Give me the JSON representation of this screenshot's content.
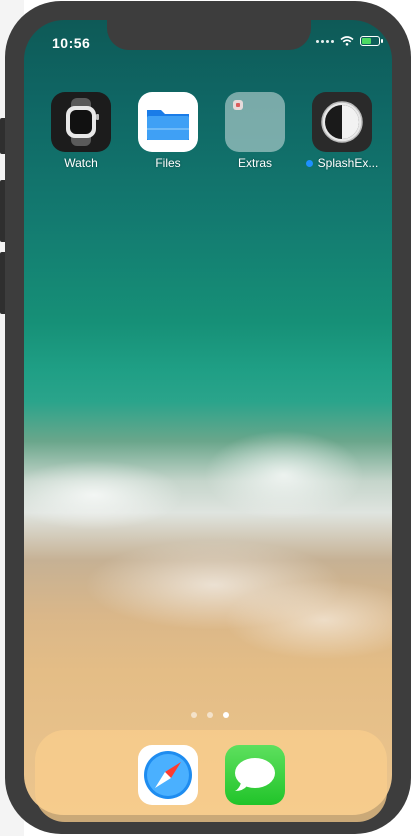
{
  "status": {
    "time": "10:56",
    "battery_color": "#4cd964"
  },
  "apps": [
    {
      "label": "Watch",
      "icon": "watch-icon"
    },
    {
      "label": "Files",
      "icon": "files-folder-icon"
    },
    {
      "label": "Extras",
      "icon": "folder-extras-icon"
    },
    {
      "label": "SplashEx...",
      "icon": "splash-app-icon",
      "new_indicator": true
    }
  ],
  "dock": [
    {
      "icon": "safari-compass-icon"
    },
    {
      "icon": "messages-bubble-icon"
    }
  ],
  "page_indicator": {
    "pages": 3,
    "current": 3
  }
}
